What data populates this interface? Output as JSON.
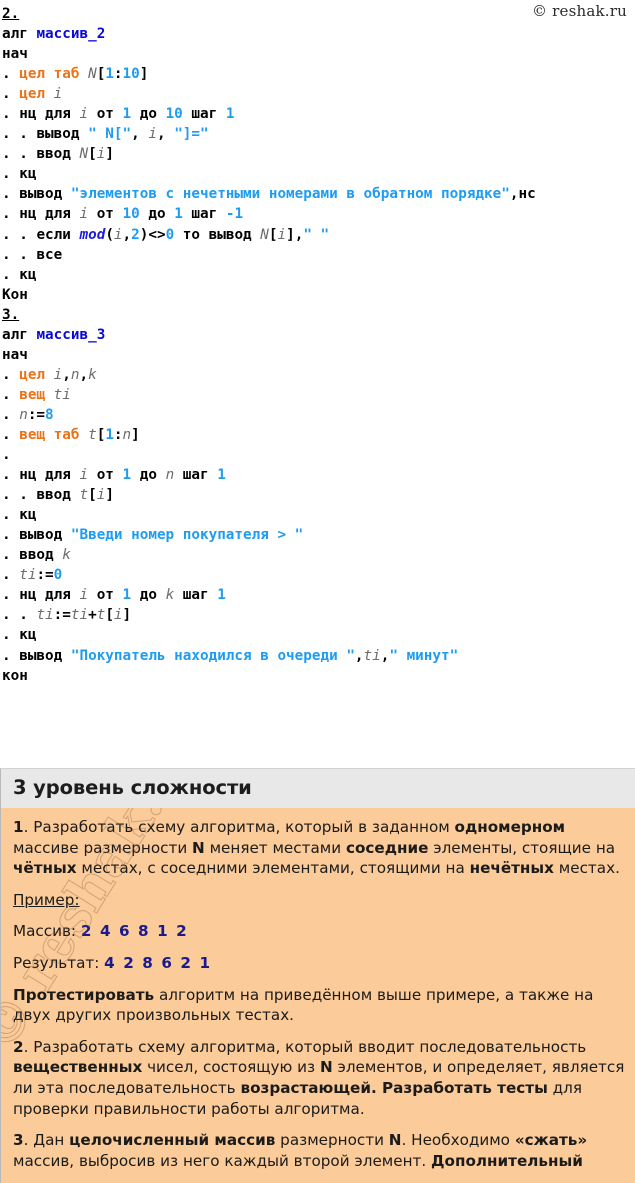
{
  "copyright": "© reshak.ru",
  "code_blocks": [
    {
      "number": "2.",
      "lines": [
        [
          {
            "t": "алг ",
            "c": "kw"
          },
          {
            "t": "массив_2",
            "c": "name"
          }
        ],
        [
          {
            "t": "нач",
            "c": "kw"
          }
        ],
        [
          {
            "t": ". ",
            "c": "dot"
          },
          {
            "t": "цел таб ",
            "c": "type"
          },
          {
            "t": "N",
            "c": "ident"
          },
          {
            "t": "[",
            "c": "op"
          },
          {
            "t": "1",
            "c": "num"
          },
          {
            "t": ":",
            "c": "op"
          },
          {
            "t": "10",
            "c": "num"
          },
          {
            "t": "]",
            "c": "op"
          }
        ],
        [
          {
            "t": ". ",
            "c": "dot"
          },
          {
            "t": "цел ",
            "c": "type"
          },
          {
            "t": "i",
            "c": "ident"
          }
        ],
        [
          {
            "t": ". ",
            "c": "dot"
          },
          {
            "t": "нц для ",
            "c": "kw"
          },
          {
            "t": "i",
            "c": "ident"
          },
          {
            "t": " от ",
            "c": "kw"
          },
          {
            "t": "1",
            "c": "num"
          },
          {
            "t": " до ",
            "c": "kw"
          },
          {
            "t": "10",
            "c": "num"
          },
          {
            "t": " шаг ",
            "c": "kw"
          },
          {
            "t": "1",
            "c": "num"
          }
        ],
        [
          {
            "t": ". . ",
            "c": "dot"
          },
          {
            "t": "вывод ",
            "c": "kw"
          },
          {
            "t": "\" N[\"",
            "c": "str"
          },
          {
            "t": ", ",
            "c": "op"
          },
          {
            "t": "i",
            "c": "ident"
          },
          {
            "t": ", ",
            "c": "op"
          },
          {
            "t": "\"]=\"",
            "c": "str"
          }
        ],
        [
          {
            "t": ". . ",
            "c": "dot"
          },
          {
            "t": "ввод ",
            "c": "kw"
          },
          {
            "t": "N",
            "c": "ident"
          },
          {
            "t": "[",
            "c": "op"
          },
          {
            "t": "i",
            "c": "ident"
          },
          {
            "t": "]",
            "c": "op"
          }
        ],
        [
          {
            "t": ". ",
            "c": "dot"
          },
          {
            "t": "кц",
            "c": "kw"
          }
        ],
        [
          {
            "t": ". ",
            "c": "dot"
          },
          {
            "t": "вывод ",
            "c": "kw"
          },
          {
            "t": "\"элементов с нечетными номерами в обратном порядке\"",
            "c": "str"
          },
          {
            "t": ",",
            "c": "op"
          },
          {
            "t": "нс",
            "c": "kw"
          }
        ],
        [
          {
            "t": ". ",
            "c": "dot"
          },
          {
            "t": "нц для ",
            "c": "kw"
          },
          {
            "t": "i",
            "c": "ident"
          },
          {
            "t": " от ",
            "c": "kw"
          },
          {
            "t": "10",
            "c": "num"
          },
          {
            "t": " до ",
            "c": "kw"
          },
          {
            "t": "1",
            "c": "num"
          },
          {
            "t": " шаг ",
            "c": "kw"
          },
          {
            "t": "-1",
            "c": "num"
          }
        ],
        [
          {
            "t": ". . ",
            "c": "dot"
          },
          {
            "t": "если ",
            "c": "kw"
          },
          {
            "t": "mod",
            "c": "fn"
          },
          {
            "t": "(",
            "c": "op"
          },
          {
            "t": "i",
            "c": "ident"
          },
          {
            "t": ",",
            "c": "op"
          },
          {
            "t": "2",
            "c": "num"
          },
          {
            "t": ")<>",
            "c": "op"
          },
          {
            "t": "0",
            "c": "num"
          },
          {
            "t": " то вывод ",
            "c": "kw"
          },
          {
            "t": "N",
            "c": "ident"
          },
          {
            "t": "[",
            "c": "op"
          },
          {
            "t": "i",
            "c": "ident"
          },
          {
            "t": "]",
            "c": "op"
          },
          {
            "t": ",",
            "c": "op"
          },
          {
            "t": "\" \"",
            "c": "str"
          }
        ],
        [
          {
            "t": ". . ",
            "c": "dot"
          },
          {
            "t": "все",
            "c": "kw"
          }
        ],
        [
          {
            "t": ". ",
            "c": "dot"
          },
          {
            "t": "кц",
            "c": "kw"
          }
        ],
        [
          {
            "t": "Кон",
            "c": "kw"
          }
        ]
      ]
    },
    {
      "number": "3.",
      "lines": [
        [
          {
            "t": "алг ",
            "c": "kw"
          },
          {
            "t": "массив_3",
            "c": "name"
          }
        ],
        [
          {
            "t": "нач",
            "c": "kw"
          }
        ],
        [
          {
            "t": ". ",
            "c": "dot"
          },
          {
            "t": "цел ",
            "c": "type"
          },
          {
            "t": "i",
            "c": "ident"
          },
          {
            "t": ",",
            "c": "op"
          },
          {
            "t": "n",
            "c": "ident"
          },
          {
            "t": ",",
            "c": "op"
          },
          {
            "t": "k",
            "c": "ident"
          }
        ],
        [
          {
            "t": ". ",
            "c": "dot"
          },
          {
            "t": "вещ ",
            "c": "type"
          },
          {
            "t": "ti",
            "c": "ident"
          }
        ],
        [
          {
            "t": ". ",
            "c": "dot"
          },
          {
            "t": "n",
            "c": "ident"
          },
          {
            "t": ":=",
            "c": "op"
          },
          {
            "t": "8",
            "c": "num"
          }
        ],
        [
          {
            "t": ". ",
            "c": "dot"
          },
          {
            "t": "вещ таб ",
            "c": "type"
          },
          {
            "t": "t",
            "c": "ident"
          },
          {
            "t": "[",
            "c": "op"
          },
          {
            "t": "1",
            "c": "num"
          },
          {
            "t": ":",
            "c": "op"
          },
          {
            "t": "n",
            "c": "ident"
          },
          {
            "t": "]",
            "c": "op"
          }
        ],
        [
          {
            "t": ".",
            "c": "dot"
          }
        ],
        [
          {
            "t": ". ",
            "c": "dot"
          },
          {
            "t": "нц для ",
            "c": "kw"
          },
          {
            "t": "i",
            "c": "ident"
          },
          {
            "t": " от ",
            "c": "kw"
          },
          {
            "t": "1",
            "c": "num"
          },
          {
            "t": " до ",
            "c": "kw"
          },
          {
            "t": "n",
            "c": "ident"
          },
          {
            "t": " шаг ",
            "c": "kw"
          },
          {
            "t": "1",
            "c": "num"
          }
        ],
        [
          {
            "t": ". . ",
            "c": "dot"
          },
          {
            "t": "ввод ",
            "c": "kw"
          },
          {
            "t": "t",
            "c": "ident"
          },
          {
            "t": "[",
            "c": "op"
          },
          {
            "t": "i",
            "c": "ident"
          },
          {
            "t": "]",
            "c": "op"
          }
        ],
        [
          {
            "t": ". ",
            "c": "dot"
          },
          {
            "t": "кц",
            "c": "kw"
          }
        ],
        [
          {
            "t": ". ",
            "c": "dot"
          },
          {
            "t": "вывод ",
            "c": "kw"
          },
          {
            "t": "\"Введи номер покупателя > \"",
            "c": "str"
          }
        ],
        [
          {
            "t": ". ",
            "c": "dot"
          },
          {
            "t": "ввод ",
            "c": "kw"
          },
          {
            "t": "k",
            "c": "ident"
          }
        ],
        [
          {
            "t": ". ",
            "c": "dot"
          },
          {
            "t": "ti",
            "c": "ident"
          },
          {
            "t": ":=",
            "c": "op"
          },
          {
            "t": "0",
            "c": "num"
          }
        ],
        [
          {
            "t": ". ",
            "c": "dot"
          },
          {
            "t": "нц для ",
            "c": "kw"
          },
          {
            "t": "i",
            "c": "ident"
          },
          {
            "t": " от ",
            "c": "kw"
          },
          {
            "t": "1",
            "c": "num"
          },
          {
            "t": " до ",
            "c": "kw"
          },
          {
            "t": "k",
            "c": "ident"
          },
          {
            "t": " шаг ",
            "c": "kw"
          },
          {
            "t": "1",
            "c": "num"
          }
        ],
        [
          {
            "t": ". . ",
            "c": "dot"
          },
          {
            "t": "ti",
            "c": "ident"
          },
          {
            "t": ":=",
            "c": "op"
          },
          {
            "t": "ti",
            "c": "ident"
          },
          {
            "t": "+",
            "c": "op"
          },
          {
            "t": "t",
            "c": "ident"
          },
          {
            "t": "[",
            "c": "op"
          },
          {
            "t": "i",
            "c": "ident"
          },
          {
            "t": "]",
            "c": "op"
          }
        ],
        [
          {
            "t": ". ",
            "c": "dot"
          },
          {
            "t": "кц",
            "c": "kw"
          }
        ],
        [
          {
            "t": ". ",
            "c": "dot"
          },
          {
            "t": "вывод ",
            "c": "kw"
          },
          {
            "t": "\"Покупатель находился в очереди \"",
            "c": "str"
          },
          {
            "t": ",",
            "c": "op"
          },
          {
            "t": "ti",
            "c": "ident"
          },
          {
            "t": ",",
            "c": "op"
          },
          {
            "t": "\" минут\"",
            "c": "str"
          }
        ],
        [
          {
            "t": "кон",
            "c": "kw"
          }
        ]
      ]
    }
  ],
  "level": {
    "header": "3 уровень сложности",
    "tasks": [
      {
        "id": "task-1",
        "parts": [
          {
            "t": "1",
            "b": true
          },
          {
            "t": ". Разработать схему алгоритма, который в заданном "
          },
          {
            "t": "одномерном",
            "b": true
          },
          {
            "t": " массиве размерности "
          },
          {
            "t": "N",
            "b": true
          },
          {
            "t": " меняет местами "
          },
          {
            "t": "соседние",
            "b": true
          },
          {
            "t": " элементы, стоящие на "
          },
          {
            "t": "чётных",
            "b": true
          },
          {
            "t": " местах, с соседними элементами, стоящими на "
          },
          {
            "t": "нечётных",
            "b": true
          },
          {
            "t": " местах."
          }
        ]
      },
      {
        "id": "example-label",
        "parts": [
          {
            "t": "Пример:",
            "u": true
          }
        ]
      },
      {
        "id": "example-input",
        "parts": [
          {
            "t": "Массив: "
          },
          {
            "t": "2 4 6 8 1 2",
            "arr": true
          }
        ]
      },
      {
        "id": "example-output",
        "parts": [
          {
            "t": "Результат: "
          },
          {
            "t": "4 2 8 6 2 1",
            "arr": true
          }
        ]
      },
      {
        "id": "test-note",
        "parts": [
          {
            "t": "Протестировать",
            "b": true
          },
          {
            "t": " алгоритм на приведённом выше примере, а также на двух других произвольных тестах."
          }
        ]
      },
      {
        "id": "task-2",
        "parts": [
          {
            "t": "2",
            "b": true
          },
          {
            "t": ". Разработать схему алгоритма, который вводит последовательность "
          },
          {
            "t": "вещественных",
            "b": true
          },
          {
            "t": " чисел, состоящую из "
          },
          {
            "t": "N",
            "b": true
          },
          {
            "t": " элементов, и определяет, является ли эта последовательность "
          },
          {
            "t": "возрастающей. Разработать тесты",
            "b": true
          },
          {
            "t": " для проверки правильности работы алгоритма."
          }
        ]
      },
      {
        "id": "task-3",
        "parts": [
          {
            "t": "3",
            "b": true
          },
          {
            "t": ". Дан "
          },
          {
            "t": "целочисленный массив",
            "b": true
          },
          {
            "t": " размерности "
          },
          {
            "t": "N",
            "b": true
          },
          {
            "t": ". Необходимо "
          },
          {
            "t": "«сжать»",
            "b": true
          },
          {
            "t": " массив, выбросив из него каждый второй элемент. "
          },
          {
            "t": "Дополнительный",
            "b": true
          }
        ]
      }
    ]
  },
  "watermark": "© reshak.ru"
}
